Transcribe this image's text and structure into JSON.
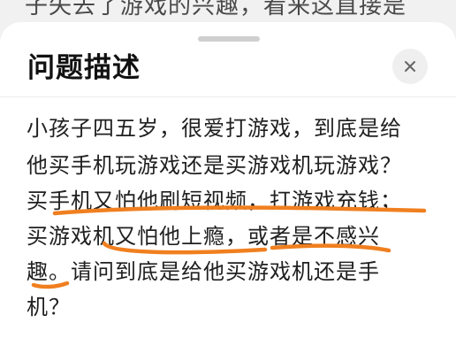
{
  "background": {
    "text": "子失去了游戏的兴趣，看来这直接是"
  },
  "sheet": {
    "title": "问题描述",
    "close_glyph": "×",
    "description_lines": [
      "小孩子四五岁，很爱打游戏，到底是给",
      "他买手机玩游戏还是买游戏机玩游戏？",
      "买手机又怕他刷短视频，打游戏充钱；",
      "买游戏机又怕他上瘾，或者是不感兴",
      "趣。请问到底是给他买游戏机还是手",
      "机？"
    ]
  },
  "colors": {
    "underline": "#f07f1f",
    "sheet_bg": "#ffffff",
    "page_bg": "#f1f1f1"
  }
}
